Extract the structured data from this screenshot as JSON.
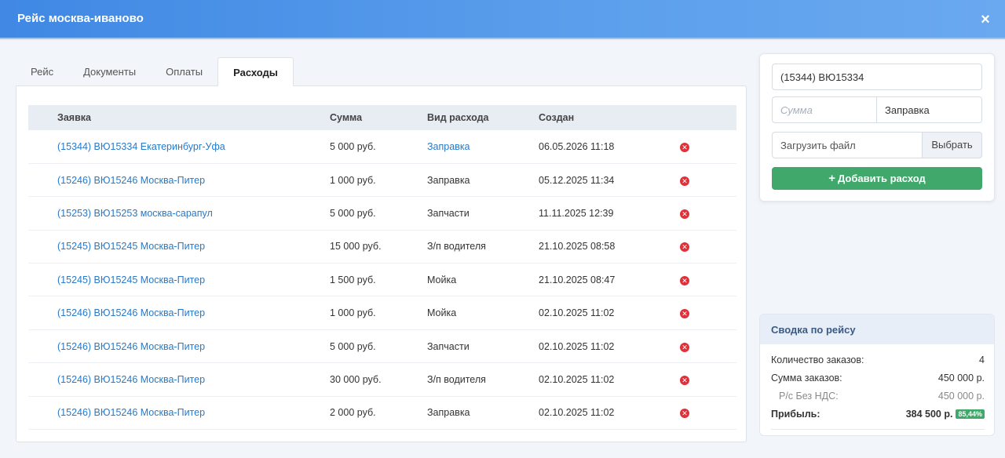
{
  "window": {
    "title": "Рейс москва-иваново",
    "close_symbol": "×"
  },
  "tabs": [
    {
      "label": "Рейс",
      "active": false
    },
    {
      "label": "Документы",
      "active": false
    },
    {
      "label": "Оплаты",
      "active": false
    },
    {
      "label": "Расходы",
      "active": true
    }
  ],
  "table": {
    "headers": [
      "Заявка",
      "Сумма",
      "Вид расхода",
      "Создан"
    ],
    "rows": [
      {
        "order": "(15344) ВЮ15334 Екатеринбург-Уфа",
        "sum": "5 000 руб.",
        "type": "Заправка",
        "type_link": true,
        "created": "06.05.2026 11:18"
      },
      {
        "order": "(15246) ВЮ15246 Москва-Питер",
        "sum": "1 000 руб.",
        "type": "Заправка",
        "type_link": false,
        "created": "05.12.2025 11:34"
      },
      {
        "order": "(15253) ВЮ15253 москва-сарапул",
        "sum": "5 000 руб.",
        "type": "Запчасти",
        "type_link": false,
        "created": "11.11.2025 12:39"
      },
      {
        "order": "(15245) ВЮ15245 Москва-Питер",
        "sum": "15 000 руб.",
        "type": "З/п водителя",
        "type_link": false,
        "created": "21.10.2025 08:58"
      },
      {
        "order": "(15245) ВЮ15245 Москва-Питер",
        "sum": "1 500 руб.",
        "type": "Мойка",
        "type_link": false,
        "created": "21.10.2025 08:47"
      },
      {
        "order": "(15246) ВЮ15246 Москва-Питер",
        "sum": "1 000 руб.",
        "type": "Мойка",
        "type_link": false,
        "created": "02.10.2025 11:02"
      },
      {
        "order": "(15246) ВЮ15246 Москва-Питер",
        "sum": "5 000 руб.",
        "type": "Запчасти",
        "type_link": false,
        "created": "02.10.2025 11:02"
      },
      {
        "order": "(15246) ВЮ15246 Москва-Питер",
        "sum": "30 000 руб.",
        "type": "З/п водителя",
        "type_link": false,
        "created": "02.10.2025 11:02"
      },
      {
        "order": "(15246) ВЮ15246 Москва-Питер",
        "sum": "2 000 руб.",
        "type": "Заправка",
        "type_link": false,
        "created": "02.10.2025 11:02"
      }
    ],
    "delete_icon": "close-circle-icon"
  },
  "form": {
    "order_value": "(15344) ВЮ15334",
    "sum_placeholder": "Сумма",
    "expense_type_value": "Заправка",
    "file_placeholder": "Загрузить файл",
    "choose_label": "Выбрать",
    "add_label": "Добавить расход"
  },
  "summary": {
    "title": "Сводка по рейсу",
    "orders_count_label": "Количество заказов:",
    "orders_count_value": "4",
    "orders_sum_label": "Сумма заказов:",
    "orders_sum_value": "450 000 р.",
    "no_vat_label": "Р/с Без НДС:",
    "no_vat_value": "450 000 р.",
    "profit_label": "Прибыль:",
    "profit_value": "384 500 р.",
    "profit_percent": "85,44%"
  },
  "colors": {
    "header": "#4a8fe6",
    "accent_green": "#3fa86a",
    "link": "#2879c7",
    "delete": "#e0303a"
  }
}
